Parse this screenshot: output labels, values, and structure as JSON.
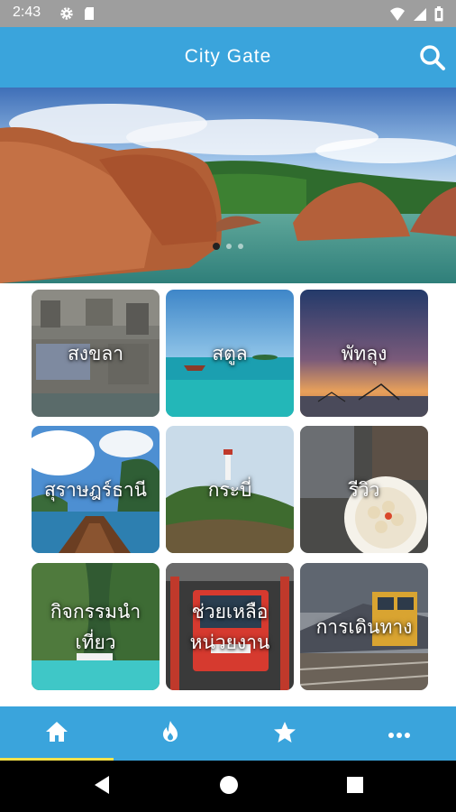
{
  "status_bar": {
    "time": "2:43",
    "left_icons": [
      "gear-icon",
      "sd-card-icon"
    ],
    "right_icons": [
      "wifi-icon",
      "signal-icon",
      "battery-icon"
    ]
  },
  "app_bar": {
    "title": "City Gate",
    "search_icon": "search-icon"
  },
  "banner": {
    "slide_count": 3,
    "active_slide": 1
  },
  "tiles": [
    {
      "id": "songkhla",
      "label": "สงขลา"
    },
    {
      "id": "satun",
      "label": "สตูล"
    },
    {
      "id": "phatthalung",
      "label": "พัทลุง"
    },
    {
      "id": "surat-thani",
      "label": "สุราษฎร์ธานี"
    },
    {
      "id": "krabi",
      "label": "กระบี่"
    },
    {
      "id": "review",
      "label": "รีวิว"
    },
    {
      "id": "activities",
      "label": "กิจกรรมนำเที่ยว"
    },
    {
      "id": "rescue",
      "label": "ช่วยเหลือหน่วยงาน"
    },
    {
      "id": "transport",
      "label": "การเดินทาง"
    }
  ],
  "bottom_nav": {
    "items": [
      "home-icon",
      "fire-icon",
      "star-icon",
      "more-icon"
    ],
    "active": "home-icon"
  },
  "system_nav": [
    "back-icon",
    "home-circle-icon",
    "recents-icon"
  ],
  "colors": {
    "primary": "#3aa4dc",
    "status_bar": "#9e9e9e",
    "indicator": "#f4e14a"
  }
}
